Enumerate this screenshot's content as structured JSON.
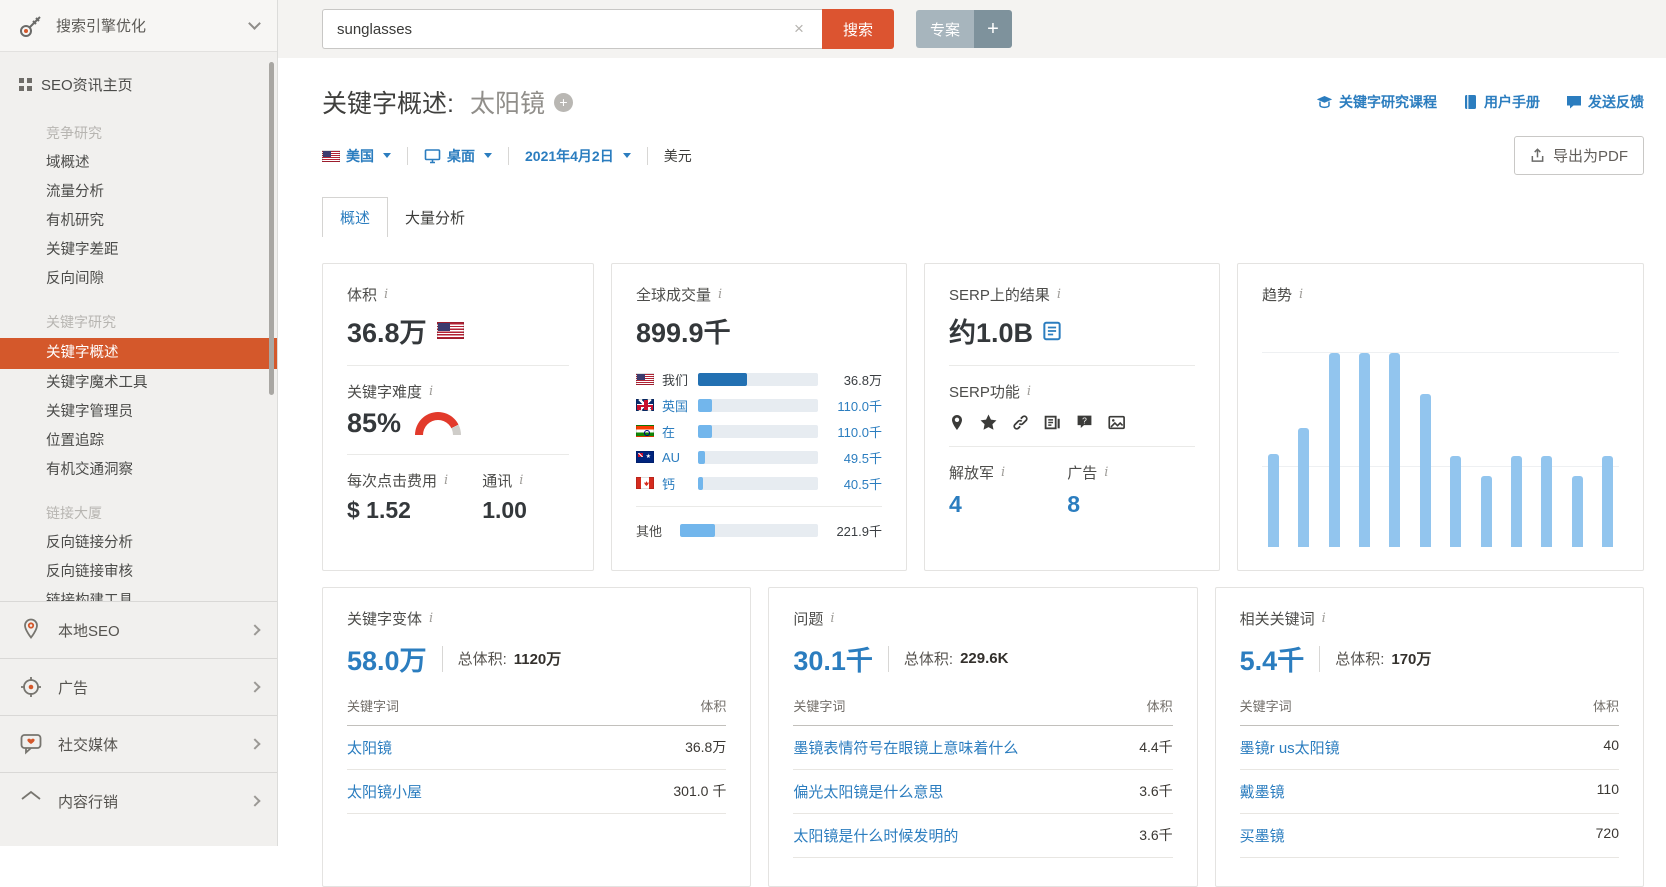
{
  "sidebar": {
    "title": "搜索引擎优化",
    "home_item": "SEO资讯主页",
    "sections": [
      {
        "label": "竞争研究",
        "items": [
          "域概述",
          "流量分析",
          "有机研究",
          "关键字差距",
          "反向间隙"
        ]
      },
      {
        "label": "关键字研究",
        "items": [
          "关键字概述",
          "关键字魔术工具",
          "关键字管理员",
          "位置追踪",
          "有机交通洞察"
        ]
      },
      {
        "label": "链接大厦",
        "items": [
          "反向链接分析",
          "反向链接审核",
          "链接构建工具"
        ]
      }
    ],
    "bottom_items": [
      {
        "label": "本地SEO"
      },
      {
        "label": "广告"
      },
      {
        "label": "社交媒体"
      },
      {
        "label": "内容行销"
      }
    ]
  },
  "topbar": {
    "search_value": "sunglasses",
    "search_label": "搜索",
    "project_label": "专案",
    "add_label": "+"
  },
  "page": {
    "title": "关键字概述:",
    "keyword": "太阳镜",
    "links": [
      {
        "label": "关键字研究课程"
      },
      {
        "label": "用户手册"
      },
      {
        "label": "发送反馈"
      }
    ],
    "export_label": "导出为PDF",
    "filters": {
      "country": "美国",
      "device": "桌面",
      "date": "2021年4月2日",
      "currency": "美元"
    },
    "tabs": [
      {
        "label": "概述"
      },
      {
        "label": "大量分析"
      }
    ]
  },
  "cards": {
    "volume": {
      "label": "体积",
      "value": "36.8万"
    },
    "difficulty": {
      "label": "关键字难度",
      "value": "85%"
    },
    "cpc": {
      "label": "每次点击费用",
      "value": "$ 1.52",
      "com_label": "通讯",
      "com_value": "1.00"
    },
    "global_volume": {
      "label": "全球成交量",
      "value": "899.9千",
      "rows": [
        {
          "country": "我们",
          "value": "36.8万",
          "pct": 41
        },
        {
          "country": "英国",
          "value": "110.0千",
          "pct": 12
        },
        {
          "country": "在",
          "value": "110.0千",
          "pct": 12
        },
        {
          "country": "AU",
          "value": "49.5千",
          "pct": 5.5
        },
        {
          "country": "钙",
          "value": "40.5千",
          "pct": 4.5
        }
      ],
      "other": {
        "label": "其他",
        "value": "221.9千",
        "pct": 25
      }
    },
    "serp": {
      "label": "SERP上的结果",
      "value": "约1.0B",
      "features_label": "SERP功能",
      "pla_label": "解放军",
      "pla_value": "4",
      "ads_label": "广告",
      "ads_value": "8"
    },
    "trend": {
      "label": "趋势"
    }
  },
  "tables": [
    {
      "title": "关键字变体",
      "count": "58.0万",
      "total_label": "总体积:",
      "total": "1120万",
      "col_keyword": "关键字词",
      "col_volume": "体积",
      "rows": [
        {
          "keyword": "太阳镜",
          "volume": "36.8万"
        },
        {
          "keyword": "太阳镜小屋",
          "volume": "301.0 千"
        }
      ]
    },
    {
      "title": "问题",
      "count": "30.1千",
      "total_label": "总体积:",
      "total": "229.6K",
      "col_keyword": "关键字词",
      "col_volume": "体积",
      "rows": [
        {
          "keyword": "墨镜表情符号在眼镜上意味着什么",
          "volume": "4.4千"
        },
        {
          "keyword": "偏光太阳镜是什么意思",
          "volume": "3.6千"
        },
        {
          "keyword": "太阳镜是什么时候发明的",
          "volume": "3.6千"
        }
      ]
    },
    {
      "title": "相关关键词",
      "count": "5.4千",
      "total_label": "总体积:",
      "total": "170万",
      "col_keyword": "关键字词",
      "col_volume": "体积",
      "rows": [
        {
          "keyword": "墨镜r us太阳镜",
          "volume": "40"
        },
        {
          "keyword": "戴墨镜",
          "volume": "110"
        },
        {
          "keyword": "买墨镜",
          "volume": "720"
        }
      ]
    }
  ],
  "chart_data": [
    {
      "type": "bar",
      "title": "趋势",
      "legend_position": "none",
      "grid": true,
      "x": [
        "m1",
        "m2",
        "m3",
        "m4",
        "m5",
        "m6",
        "m7",
        "m8",
        "m9",
        "m10",
        "m11",
        "m12"
      ],
      "values_relative": [
        0.48,
        0.61,
        1.0,
        1.0,
        1.0,
        0.79,
        0.47,
        0.36,
        0.47,
        0.47,
        0.36,
        0.47
      ],
      "values_pct_of_box": [
        41,
        52,
        85,
        85,
        85,
        67,
        40,
        31,
        40,
        40,
        31,
        40
      ]
    },
    {
      "type": "bar",
      "title": "全球成交量",
      "categories": [
        "我们",
        "英国",
        "在",
        "AU",
        "钙",
        "其他"
      ],
      "values": [
        368000,
        110000,
        110000,
        49500,
        40500,
        221900
      ],
      "total": 899900
    }
  ],
  "colors": {
    "accent_orange": "#d4582b",
    "search_btn": "#dc5430",
    "link_blue": "#2b7dbf",
    "bar_dark_blue": "#2270b2",
    "bar_light_blue": "#72b6ec",
    "trend_bar": "#92c5ee",
    "kd_red": "#e23a2b",
    "sidebar_bg": "#f1f0ee",
    "topbar_bg": "#f4f3f1"
  }
}
